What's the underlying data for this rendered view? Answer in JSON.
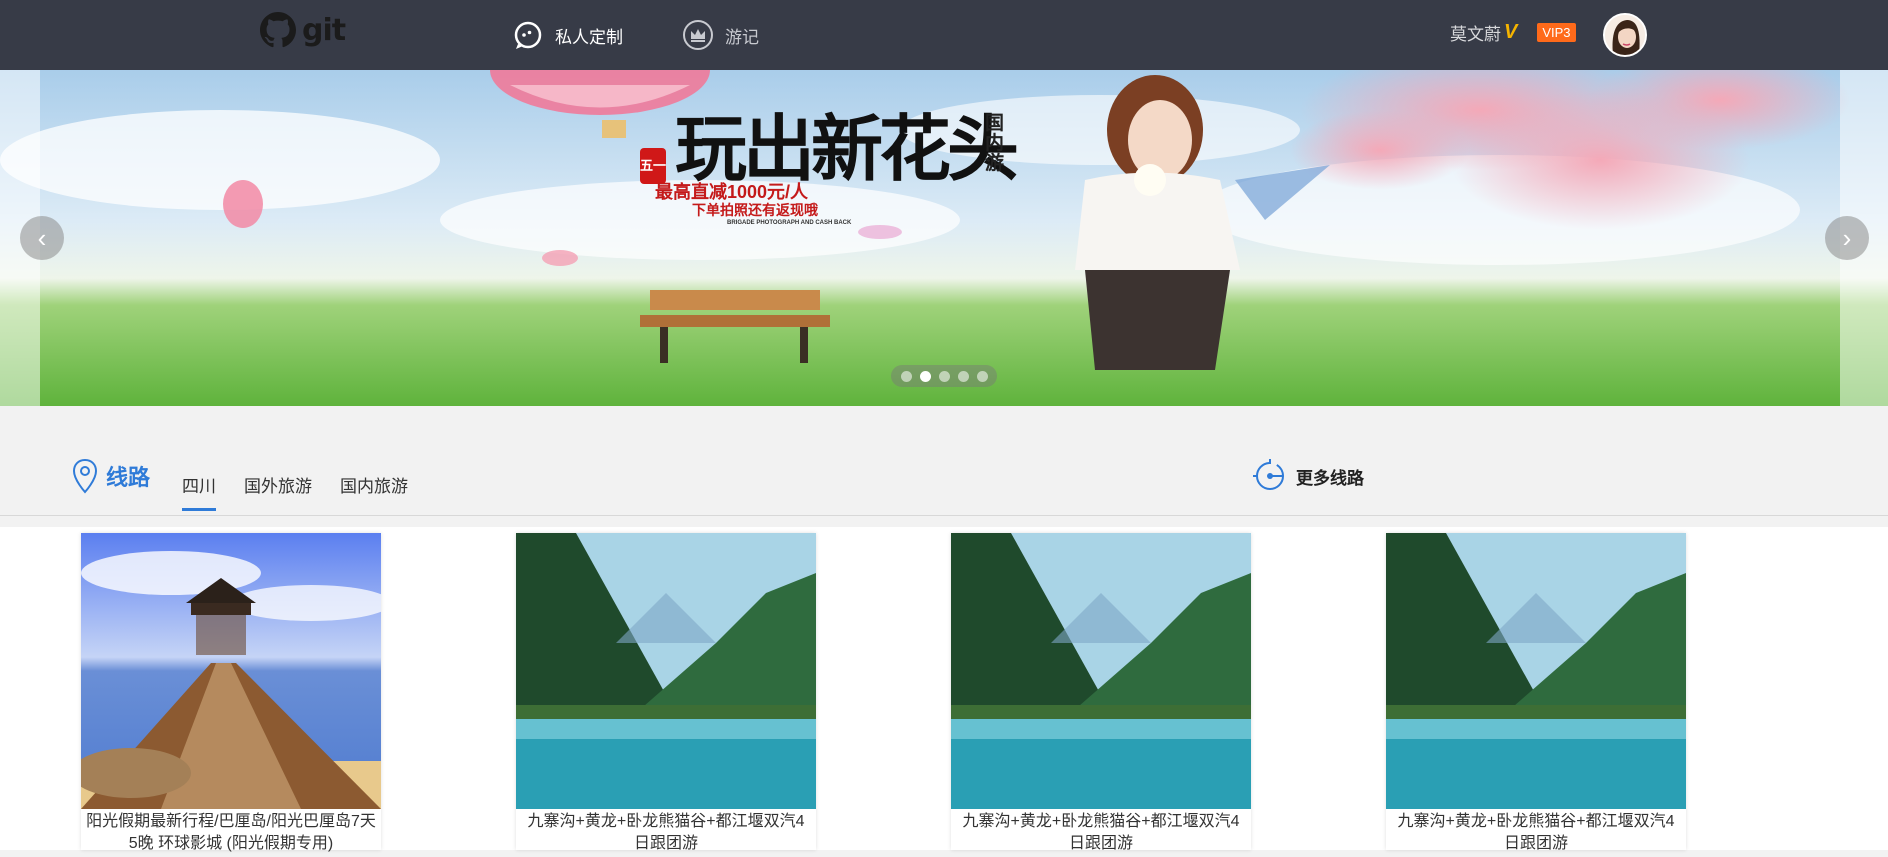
{
  "header": {
    "logo_text": "git",
    "nav": [
      {
        "label": "私人定制",
        "icon": "chat-icon"
      },
      {
        "label": "游记",
        "icon": "crown-icon"
      }
    ],
    "user": {
      "name": "莫文蔚",
      "verified_mark": "V",
      "vip_badge": "VIP3"
    }
  },
  "banner": {
    "headline_calligraphy": "玩出新花头",
    "side_text": "国内游",
    "tag": "五一",
    "promo_line1": "最高直减1000元/人",
    "promo_line2": "下单拍照还有返现哦",
    "promo_small": "BRIGADE PHOTOGRAPH AND CASH BACK",
    "prev_arrow": "‹",
    "next_arrow": "›",
    "slide_count": 5,
    "active_slide": 2
  },
  "section": {
    "title": "线路",
    "tabs": [
      {
        "label": "四川",
        "active": true
      },
      {
        "label": "国外旅游",
        "active": false
      },
      {
        "label": "国内旅游",
        "active": false
      }
    ],
    "more_label": "更多线路"
  },
  "cards": [
    {
      "caption": "阳光假期最新行程/巴厘岛/阳光巴厘岛7天5晚 环球影城 (阳光假期专用)",
      "image": "pier-gazebo-lake"
    },
    {
      "caption": "九寨沟+黄龙+卧龙熊猫谷+都江堰双汽4日跟团游",
      "image": "jiuzhaigou-lake"
    },
    {
      "caption": "九寨沟+黄龙+卧龙熊猫谷+都江堰双汽4日跟团游",
      "image": "jiuzhaigou-lake"
    },
    {
      "caption": "九寨沟+黄龙+卧龙熊猫谷+都江堰双汽4日跟团游",
      "image": "jiuzhaigou-lake"
    }
  ],
  "colors": {
    "topbar": "#373b47",
    "accent": "#2f7bd8",
    "vip": "#ff6a1a",
    "verified": "#f5b400"
  }
}
